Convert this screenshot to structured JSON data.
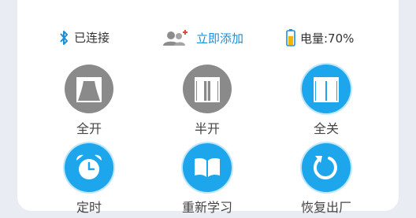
{
  "status_bar": {
    "bluetooth_label": "已连接",
    "add_label": "立即添加",
    "battery_label": "电量:70%",
    "battery_level_percent": 70,
    "icons": [
      "bluetooth-icon",
      "add-person-icon",
      "battery-icon"
    ]
  },
  "controls": [
    {
      "label": "全开",
      "icon": "curtain-open-icon",
      "color": "#8a8a8a"
    },
    {
      "label": "半开",
      "icon": "curtain-half-icon",
      "color": "#8a8a8a"
    },
    {
      "label": "全关",
      "icon": "curtain-closed-icon",
      "color": "#1ea6ec"
    },
    {
      "label": "定时",
      "icon": "alarm-clock-icon",
      "color": "#1ea6ec"
    },
    {
      "label": "重新学习",
      "icon": "book-icon",
      "color": "#1ea6ec"
    },
    {
      "label": "恢复出厂",
      "icon": "reset-icon",
      "color": "#1ea6ec"
    }
  ],
  "colors": {
    "accent": "#1ea6ec",
    "inactive": "#8a8a8a",
    "link": "#1a8fd8"
  }
}
